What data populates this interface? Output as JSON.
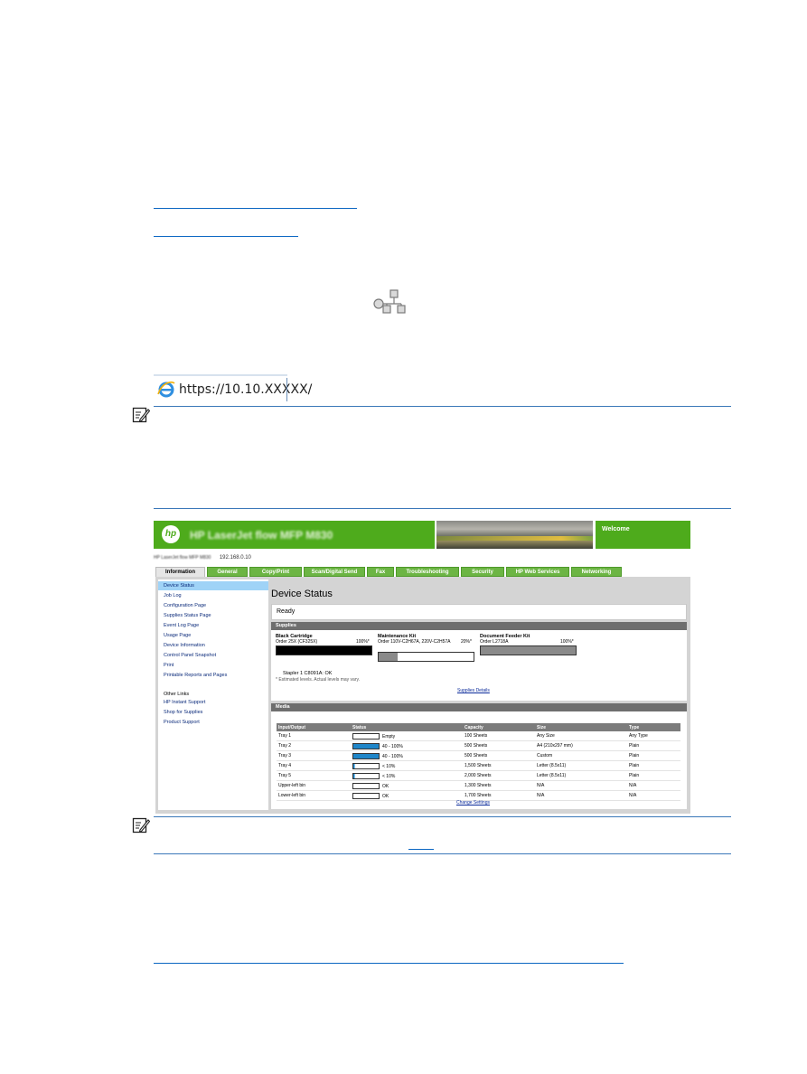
{
  "address_bar": {
    "url": "https://10.10.XXXXX/"
  },
  "ews": {
    "header_title": "HP LaserJet flow MFP M830",
    "welcome": "Welcome",
    "model_line": "HP LaserJet flow MFP M830",
    "ip": "192.168.0.10",
    "tabs": [
      "Information",
      "General",
      "Copy/Print",
      "Scan/Digital Send",
      "Fax",
      "Troubleshooting",
      "Security",
      "HP Web Services",
      "Networking"
    ],
    "nav": [
      "Device Status",
      "Job Log",
      "Configuration Page",
      "Supplies Status Page",
      "Event Log Page",
      "Usage Page",
      "Device Information",
      "Control Panel Snapshot",
      "Print",
      "Printable Reports and Pages"
    ],
    "other_links_heading": "Other Links",
    "other_links": [
      "HP Instant Support",
      "Shop for Supplies",
      "Product Support"
    ],
    "page_title": "Device Status",
    "status": "Ready",
    "supplies_heading": "Supplies",
    "supplies": [
      {
        "name": "Black Cartridge",
        "order": "Order 25X (CF325X)",
        "level": "100%*",
        "fill": 1.0,
        "color": "#000000"
      },
      {
        "name": "Maintenance Kit",
        "order": "Order 110V-C2H67A, 220V-C2H57A",
        "level": "20%*",
        "fill": 0.2,
        "color": "#8a8a8a"
      },
      {
        "name": "Document Feeder Kit",
        "order": "Order L2718A",
        "level": "100%*",
        "fill": 1.0,
        "color": "#8a8a8a"
      }
    ],
    "stapler": "Stapler 1 C8091A: OK",
    "estimate_note": "* Estimated levels. Actual levels may vary.",
    "supplies_details": "Supplies Details",
    "media_heading": "Media",
    "media_headers": [
      "Input/Output",
      "Status",
      "Capacity",
      "Size",
      "Type"
    ],
    "media_rows": [
      {
        "io": "Tray 1",
        "status": "Empty",
        "level": 0.0,
        "capacity": "100 Sheets",
        "size": "Any Size",
        "type": "Any Type"
      },
      {
        "io": "Tray 2",
        "status": "40 - 100%",
        "level": 1.0,
        "capacity": "500 Sheets",
        "size": "A4 (210x297 mm)",
        "type": "Plain"
      },
      {
        "io": "Tray 3",
        "status": "40 - 100%",
        "level": 1.0,
        "capacity": "500 Sheets",
        "size": "Custom",
        "type": "Plain"
      },
      {
        "io": "Tray 4",
        "status": "< 10%",
        "level": 0.08,
        "capacity": "1,500 Sheets",
        "size": "Letter (8.5x11)",
        "type": "Plain"
      },
      {
        "io": "Tray 5",
        "status": "< 10%",
        "level": 0.08,
        "capacity": "2,000 Sheets",
        "size": "Letter (8.5x11)",
        "type": "Plain"
      },
      {
        "io": "Upper-left bin",
        "status": "OK",
        "level": 0.0,
        "capacity": "1,300 Sheets",
        "size": "N/A",
        "type": "N/A"
      },
      {
        "io": "Lower-left bin",
        "status": "OK",
        "level": 0.0,
        "capacity": "1,700 Sheets",
        "size": "N/A",
        "type": "N/A"
      }
    ],
    "change_settings": "Change Settings"
  },
  "colors": {
    "hp_green": "#4eab1c",
    "link_blue": "#0b66c2",
    "rule_blue": "#3b78b9"
  }
}
